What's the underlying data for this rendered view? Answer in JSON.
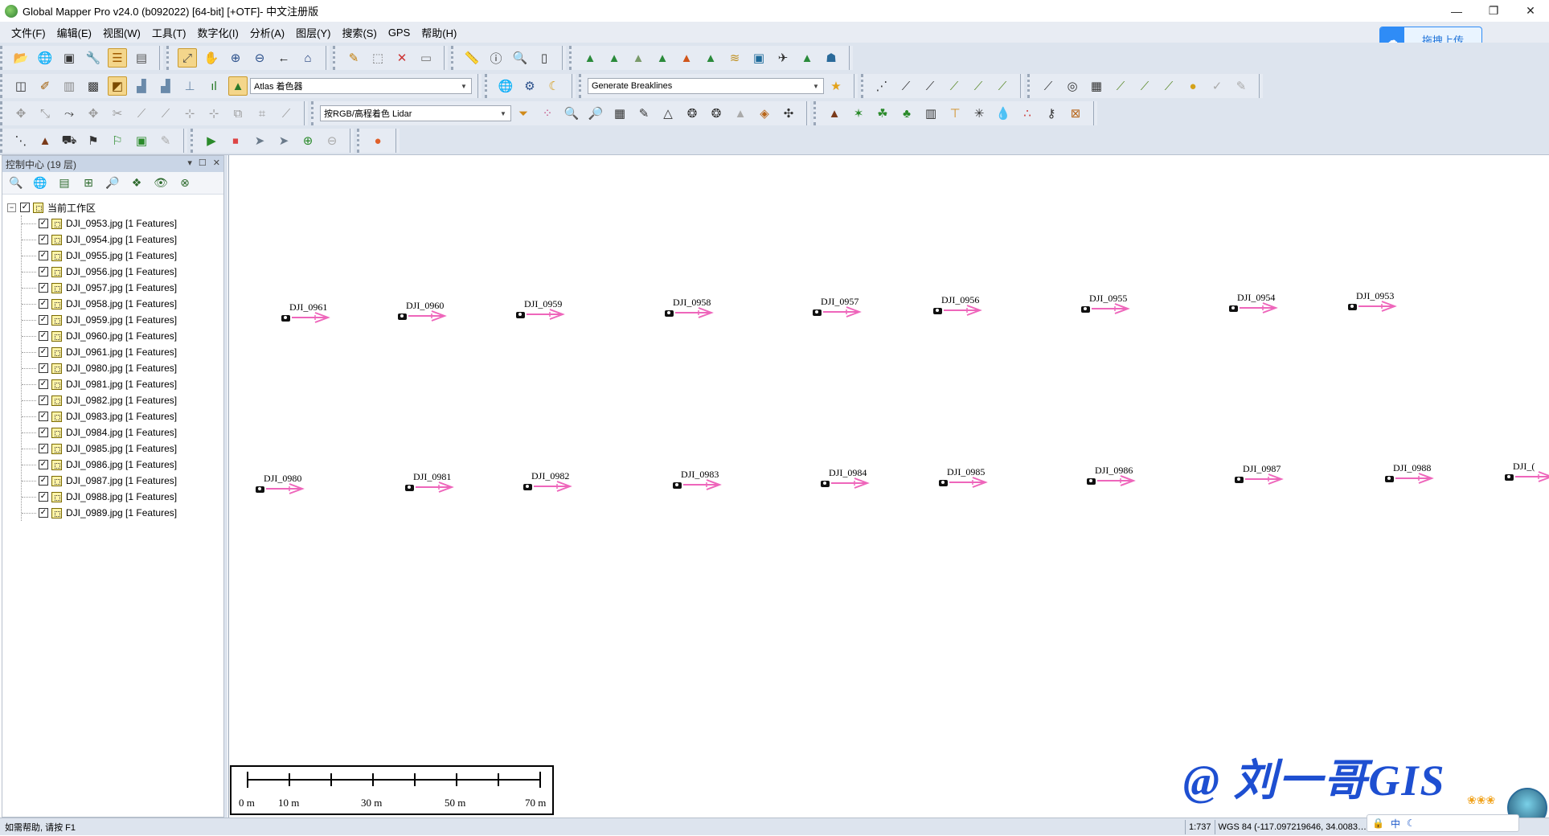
{
  "window": {
    "title": "Global Mapper Pro v24.0 (b092022) [64-bit] [+OTF]- 中文注册版",
    "controls": [
      "—",
      "❐",
      "✕"
    ]
  },
  "menu": [
    "文件(F)",
    "编辑(E)",
    "视图(W)",
    "工具(T)",
    "数字化(I)",
    "分析(A)",
    "图层(Y)",
    "搜索(S)",
    "GPS",
    "帮助(H)"
  ],
  "upload_button": "拖拽上传",
  "toolbars": {
    "row1": [
      {
        "icons": [
          "folder-open-icon",
          "globe-icon",
          "save-icon",
          "wrench-icon",
          "layers-icon",
          "table-icon"
        ]
      },
      {
        "icons": [
          "pan-zoom-icon",
          "hand-pan-icon",
          "zoom-in-icon",
          "zoom-out-icon",
          "back-arrow-icon",
          "home-icon"
        ]
      },
      {
        "icons": [
          "pencil-icon",
          "select-rect-icon",
          "delete-x-icon",
          "edit-box-icon"
        ]
      },
      {
        "icons": [
          "ruler-icon",
          "info-icon",
          "search-map-icon",
          "device-icon"
        ]
      },
      {
        "icons": [
          "terrain-1-icon",
          "terrain-2-icon",
          "terrain-3-icon",
          "terrain-4-icon",
          "terrain-5-icon",
          "terrain-6-icon",
          "terrain-7-icon",
          "terrain-8-icon",
          "terrain-9-icon",
          "terrain-10-icon",
          "terrain-11-icon"
        ]
      }
    ],
    "row2": {
      "shader_combo": "Atlas 着色器",
      "breaklines_combo": "Generate Breaklines"
    },
    "row3": {
      "lidar_combo": "按RGB/高程着色 Lidar"
    }
  },
  "panel": {
    "title": "控制中心 (19 层)",
    "header_buttons": [
      "▾",
      "☐",
      "✕"
    ],
    "root_label": "当前工作区",
    "layers": [
      "DJI_0953.jpg [1 Features]",
      "DJI_0954.jpg [1 Features]",
      "DJI_0955.jpg [1 Features]",
      "DJI_0956.jpg [1 Features]",
      "DJI_0957.jpg [1 Features]",
      "DJI_0958.jpg [1 Features]",
      "DJI_0959.jpg [1 Features]",
      "DJI_0960.jpg [1 Features]",
      "DJI_0961.jpg [1 Features]",
      "DJI_0980.jpg [1 Features]",
      "DJI_0981.jpg [1 Features]",
      "DJI_0982.jpg [1 Features]",
      "DJI_0983.jpg [1 Features]",
      "DJI_0984.jpg [1 Features]",
      "DJI_0985.jpg [1 Features]",
      "DJI_0986.jpg [1 Features]",
      "DJI_0987.jpg [1 Features]",
      "DJI_0988.jpg [1 Features]",
      "DJI_0989.jpg [1 Features]"
    ]
  },
  "map": {
    "row1_labels": [
      "DJI_0961",
      "DJI_0960",
      "DJI_0959",
      "DJI_0958",
      "DJI_0957",
      "DJI_0956",
      "DJI_0955",
      "DJI_0954",
      "DJI_0953"
    ],
    "row2_labels": [
      "DJI_0980",
      "DJI_0981",
      "DJI_0982",
      "DJI_0983",
      "DJI_0984",
      "DJI_0985",
      "DJI_0986",
      "DJI_0987",
      "DJI_0988",
      "DJI_("
    ],
    "arrow_color": "#ee66bb",
    "scale_labels": [
      "0 m",
      "10 m",
      "30 m",
      "50 m",
      "70 m"
    ],
    "watermark": "@ 刘一哥GIS"
  },
  "status": {
    "help": "如需帮助, 请按 F1",
    "scale": "1:737",
    "coords": "WGS 84 (-117.097219646, 34.0083…",
    "ime": "中"
  }
}
